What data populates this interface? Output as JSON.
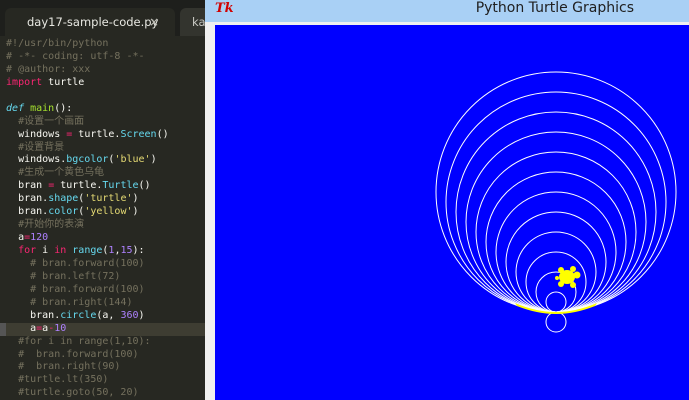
{
  "editor": {
    "tabs": [
      {
        "label": "day17-sample-code.py",
        "close": "×",
        "active": true
      },
      {
        "label": "ka",
        "active": false
      }
    ],
    "lines": [
      [
        {
          "t": "#!/usr/bin/python",
          "c": "comment"
        }
      ],
      [
        {
          "t": "# -*- coding: utf-8 -*-",
          "c": "comment"
        }
      ],
      [
        {
          "t": "# @author: xxx",
          "c": "comment"
        }
      ],
      [
        {
          "t": "import",
          "c": "kw"
        },
        {
          "t": " turtle",
          "c": ""
        }
      ],
      [
        {
          "t": "",
          "c": ""
        }
      ],
      [
        {
          "t": "def",
          "c": "def"
        },
        {
          "t": " ",
          "c": ""
        },
        {
          "t": "main",
          "c": "fn"
        },
        {
          "t": "():",
          "c": ""
        }
      ],
      [
        {
          "t": "  #设置一个画面",
          "c": "comment"
        }
      ],
      [
        {
          "t": "  windows ",
          "c": ""
        },
        {
          "t": "=",
          "c": "op"
        },
        {
          "t": " turtle.",
          "c": ""
        },
        {
          "t": "Screen",
          "c": "call"
        },
        {
          "t": "()",
          "c": ""
        }
      ],
      [
        {
          "t": "  #设置背景",
          "c": "comment"
        }
      ],
      [
        {
          "t": "  windows.",
          "c": ""
        },
        {
          "t": "bgcolor",
          "c": "call"
        },
        {
          "t": "(",
          "c": ""
        },
        {
          "t": "'blue'",
          "c": "str"
        },
        {
          "t": ")",
          "c": ""
        }
      ],
      [
        {
          "t": "  #生成一个黄色乌龟",
          "c": "comment"
        }
      ],
      [
        {
          "t": "  bran ",
          "c": ""
        },
        {
          "t": "=",
          "c": "op"
        },
        {
          "t": " turtle.",
          "c": ""
        },
        {
          "t": "Turtle",
          "c": "call"
        },
        {
          "t": "()",
          "c": ""
        }
      ],
      [
        {
          "t": "  bran.",
          "c": ""
        },
        {
          "t": "shape",
          "c": "call"
        },
        {
          "t": "(",
          "c": ""
        },
        {
          "t": "'turtle'",
          "c": "str"
        },
        {
          "t": ")",
          "c": ""
        }
      ],
      [
        {
          "t": "  bran.",
          "c": ""
        },
        {
          "t": "color",
          "c": "call"
        },
        {
          "t": "(",
          "c": ""
        },
        {
          "t": "'yellow'",
          "c": "str"
        },
        {
          "t": ")",
          "c": ""
        }
      ],
      [
        {
          "t": "  #开始你的表演",
          "c": "comment"
        }
      ],
      [
        {
          "t": "  a",
          "c": ""
        },
        {
          "t": "=",
          "c": "op"
        },
        {
          "t": "120",
          "c": "num"
        }
      ],
      [
        {
          "t": "  ",
          "c": ""
        },
        {
          "t": "for",
          "c": "kw"
        },
        {
          "t": " i ",
          "c": ""
        },
        {
          "t": "in",
          "c": "kw"
        },
        {
          "t": " ",
          "c": ""
        },
        {
          "t": "range",
          "c": "call"
        },
        {
          "t": "(",
          "c": ""
        },
        {
          "t": "1",
          "c": "num"
        },
        {
          "t": ",",
          "c": ""
        },
        {
          "t": "15",
          "c": "num"
        },
        {
          "t": "):",
          "c": ""
        }
      ],
      [
        {
          "t": "    # bran.forward(100)",
          "c": "comment"
        }
      ],
      [
        {
          "t": "    # bran.left(72)",
          "c": "comment"
        }
      ],
      [
        {
          "t": "    # bran.forward(100)",
          "c": "comment"
        }
      ],
      [
        {
          "t": "    # bran.right(144)",
          "c": "comment"
        }
      ],
      [
        {
          "t": "    bran.",
          "c": ""
        },
        {
          "t": "circle",
          "c": "call"
        },
        {
          "t": "(a, ",
          "c": ""
        },
        {
          "t": "360",
          "c": "num"
        },
        {
          "t": ")",
          "c": ""
        }
      ],
      [
        {
          "t": "    a",
          "c": ""
        },
        {
          "t": "=",
          "c": "op"
        },
        {
          "t": "a",
          "c": ""
        },
        {
          "t": "-",
          "c": "op"
        },
        {
          "t": "10",
          "c": "num"
        }
      ],
      [
        {
          "t": "  #for i in range(1,10):",
          "c": "comment"
        }
      ],
      [
        {
          "t": "  #  bran.forward(100)",
          "c": "comment"
        }
      ],
      [
        {
          "t": "  #  bran.right(90)",
          "c": "comment"
        }
      ],
      [
        {
          "t": "  #turtle.lt(350)",
          "c": "comment"
        }
      ],
      [
        {
          "t": "  #turtle.goto(50, 20)",
          "c": "comment"
        }
      ]
    ],
    "current_line": 22
  },
  "turtle_window": {
    "icon": "Tk",
    "title": "Python Turtle Graphics",
    "background": "#0000ff",
    "pen_color": "#ffff00",
    "radii": [
      120,
      110,
      100,
      90,
      80,
      70,
      60,
      50,
      40,
      30,
      20,
      10,
      0,
      -10
    ]
  }
}
